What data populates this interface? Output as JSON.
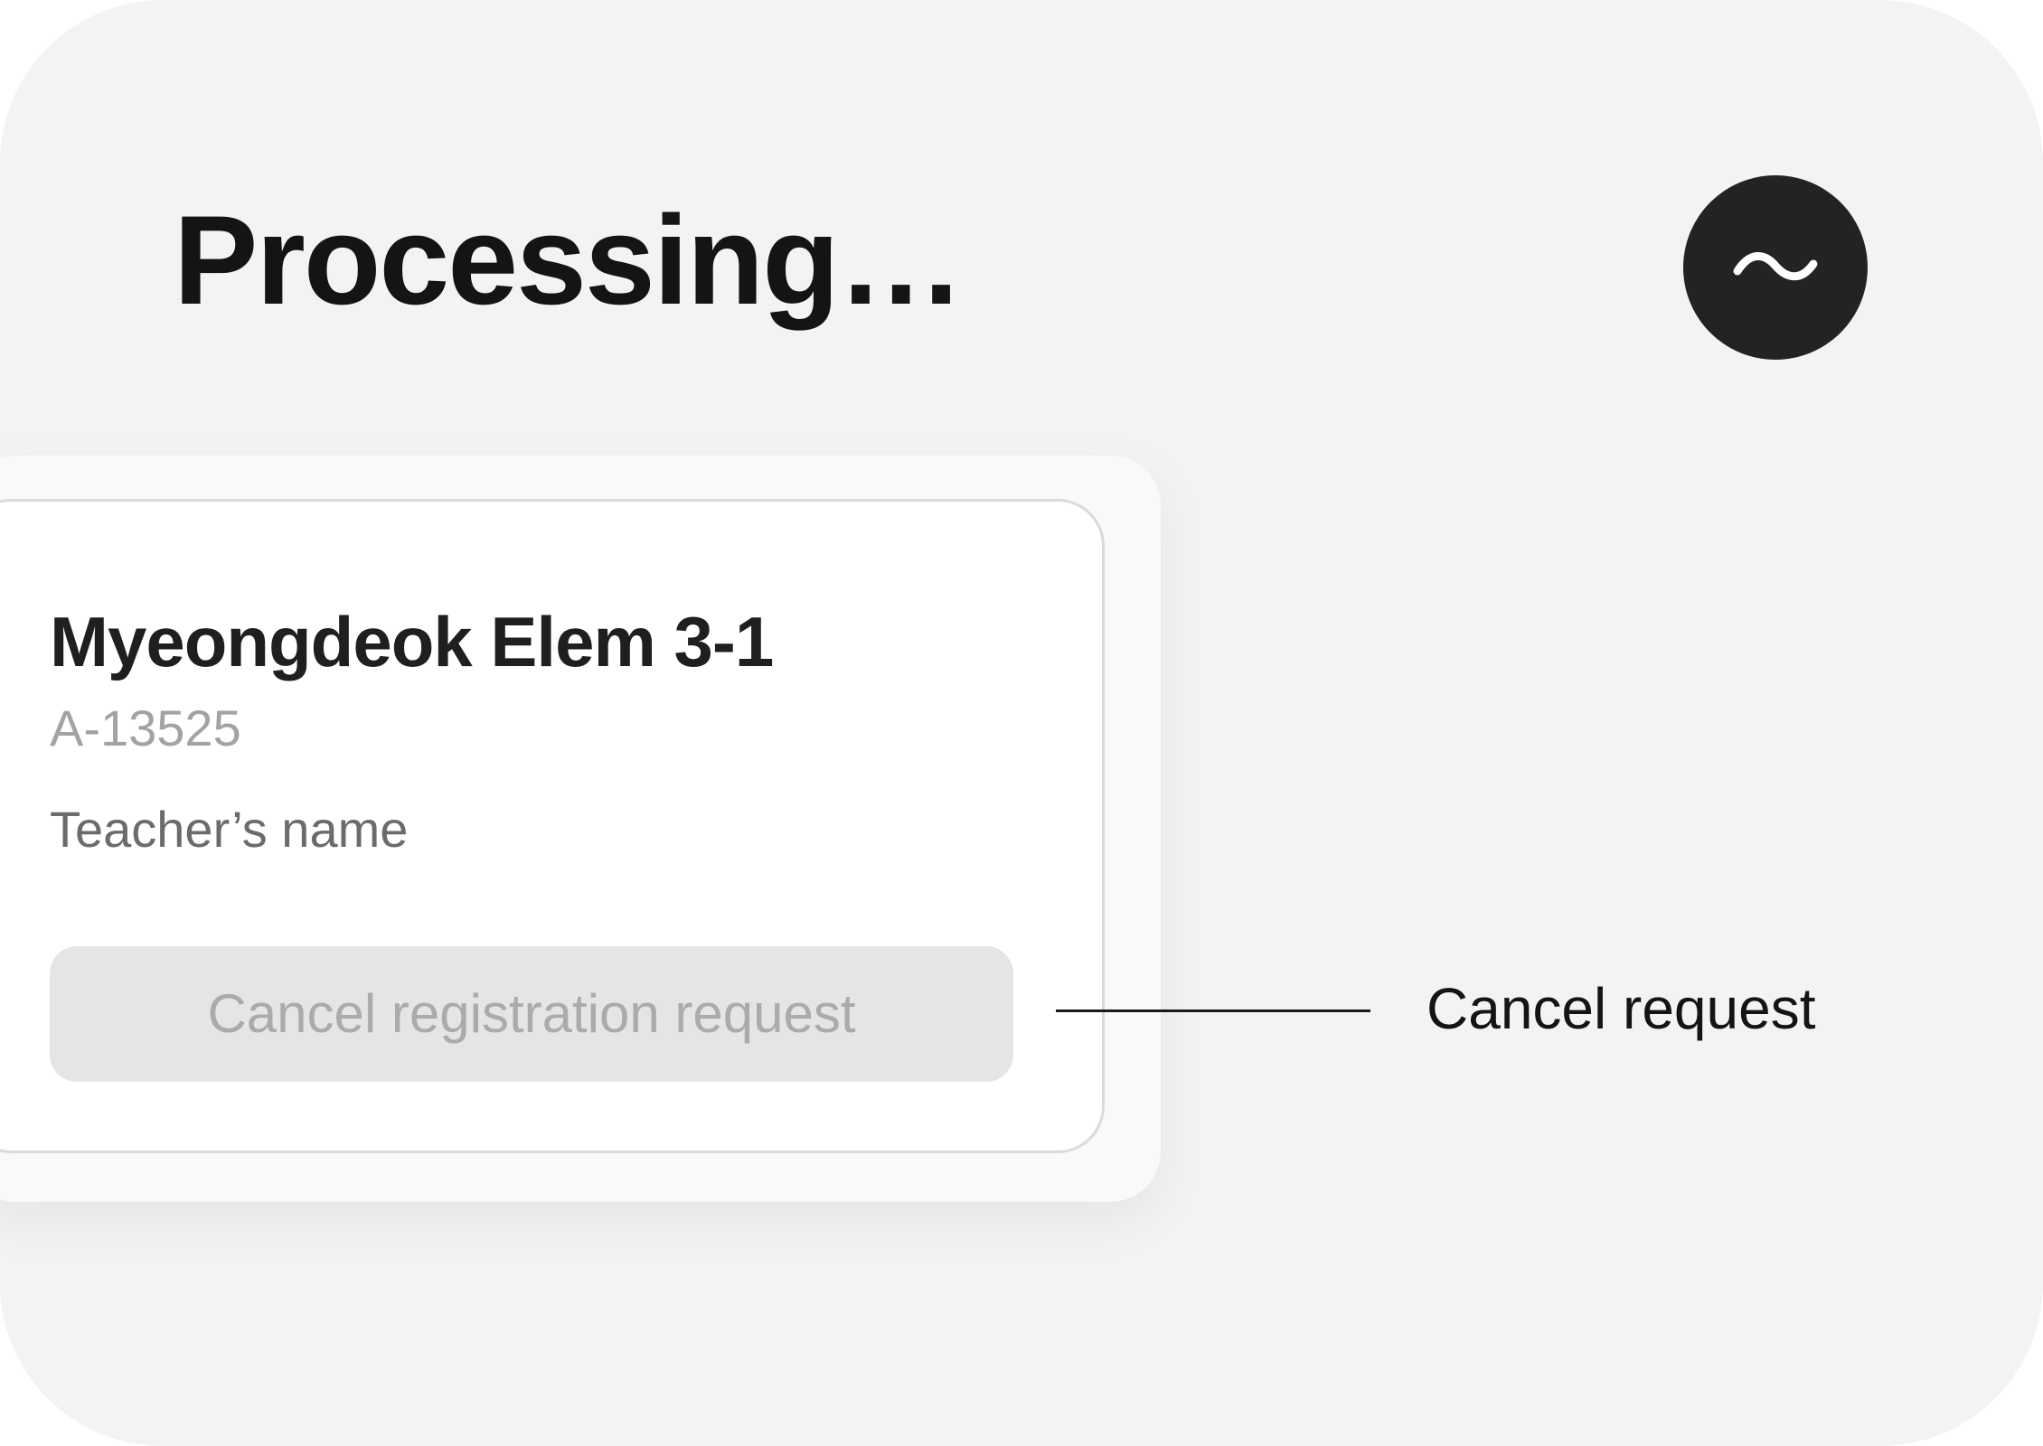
{
  "header": {
    "status_title": "Processing…",
    "status_icon": "tilde-icon"
  },
  "class_card": {
    "class_name": "Myeongdeok Elem 3-1",
    "class_code": "A-13525",
    "teacher_label": "Teacher’s name",
    "cancel_button_label": "Cancel registration request"
  },
  "annotation": {
    "label": "Cancel request"
  },
  "colors": {
    "background": "#f3f3f3",
    "badge": "#232323",
    "button_disabled_bg": "#e5e5e5",
    "button_disabled_text": "#ababab"
  }
}
